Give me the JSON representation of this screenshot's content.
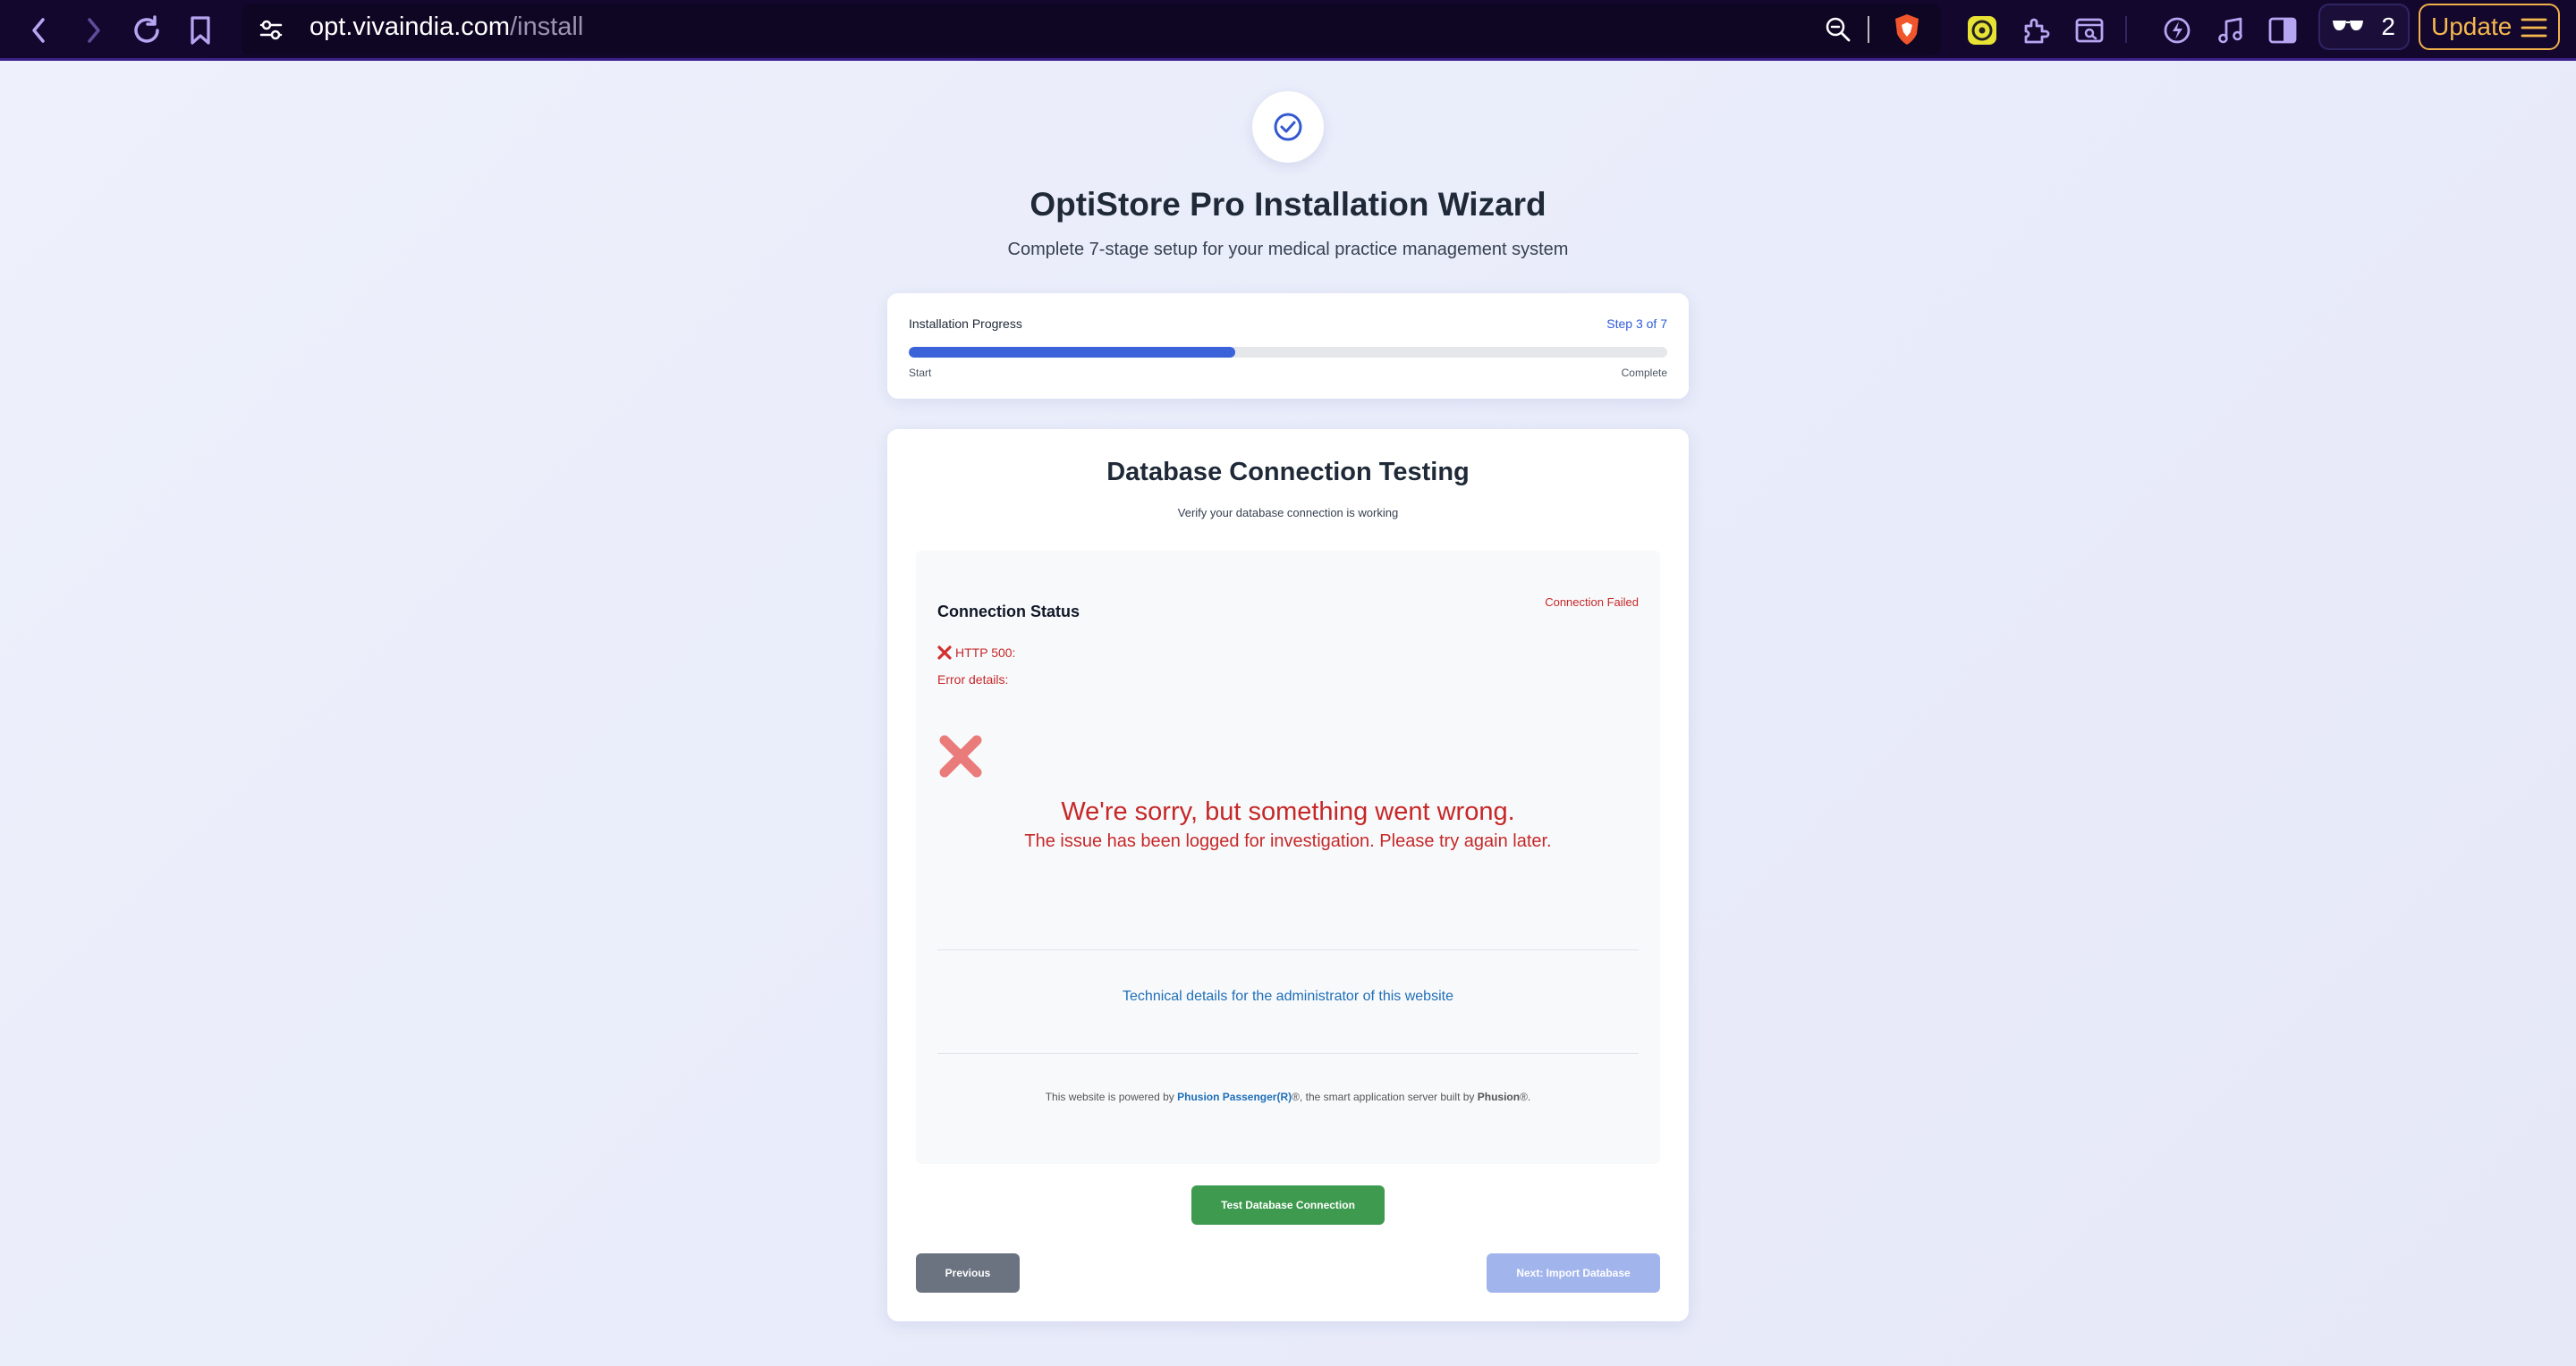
{
  "browser": {
    "url_host": "opt.vivaindia.com",
    "url_path": "/install",
    "ext_count": "2",
    "update_label": "Update"
  },
  "header": {
    "title": "OptiStore Pro Installation Wizard",
    "subtitle": "Complete 7-stage setup for your medical practice management system"
  },
  "progress": {
    "label": "Installation Progress",
    "step": "Step 3 of 7",
    "fraction": 0.43,
    "start": "Start",
    "end": "Complete"
  },
  "section": {
    "title": "Database Connection Testing",
    "subtitle": "Verify your database connection is working"
  },
  "status": {
    "title": "Connection Status",
    "badge": "Connection Failed",
    "http": "HTTP 500:",
    "error_label": "Error details:",
    "sorry": "We're sorry, but something went wrong.",
    "sorry_sub": "The issue has been logged for investigation. Please try again later.",
    "tech_link": "Technical details for the administrator of this website",
    "powered_prefix": "This website is powered by ",
    "powered_product": "Phusion Passenger(R)",
    "powered_mid": "®, the smart application server built by ",
    "powered_company": "Phusion",
    "powered_suffix": "®."
  },
  "buttons": {
    "test": "Test Database Connection",
    "previous": "Previous",
    "next": "Next: Import Database"
  },
  "colors": {
    "toolbar_bg": "#14072e",
    "accent_blue": "#3a62d9",
    "error_red": "#c62828",
    "success_green": "#3e9a4e",
    "update_orange": "#f5b84e"
  }
}
